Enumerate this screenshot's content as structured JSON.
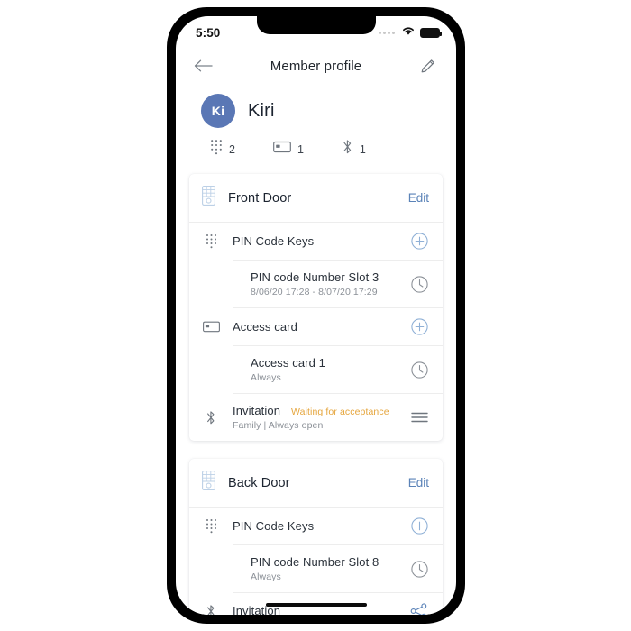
{
  "status_bar": {
    "time": "5:50",
    "signal_icon": "signal-dots-icon",
    "wifi_icon": "wifi-icon",
    "battery_icon": "battery-icon"
  },
  "nav": {
    "back_icon": "back-arrow-icon",
    "title": "Member profile",
    "edit_icon": "pencil-icon"
  },
  "profile": {
    "initials": "Ki",
    "name": "Kiri",
    "avatar_color": "#5a77b5",
    "stats": [
      {
        "icon": "keypad-icon",
        "label": "pin-codes",
        "value": "2"
      },
      {
        "icon": "card-icon",
        "label": "access-cards",
        "value": "1"
      },
      {
        "icon": "bluetooth-icon",
        "label": "invitations",
        "value": "1"
      }
    ]
  },
  "colors": {
    "accent_blue": "#5b83b8",
    "action_blue": "#7596c4",
    "pending_orange": "#e5a53c",
    "muted_gray": "#8b9097"
  },
  "cards": [
    {
      "id": "front-door",
      "icon": "door-lock-icon",
      "title": "Front Door",
      "edit_label": "Edit",
      "rows": [
        {
          "id": "pin-code-keys",
          "icon": "keypad-icon",
          "title": "PIN Code Keys",
          "sub": "",
          "tag": "",
          "action_icon": "plus-circle-icon",
          "indent": false
        },
        {
          "id": "pin-code-slot-3",
          "icon": "",
          "title": "PIN code Number Slot 3",
          "sub": "8/06/20 17:28 - 8/07/20 17:29",
          "tag": "",
          "action_icon": "clock-icon",
          "indent": true
        },
        {
          "id": "access-card",
          "icon": "card-icon",
          "title": "Access card",
          "sub": "",
          "tag": "",
          "action_icon": "plus-circle-icon",
          "indent": false
        },
        {
          "id": "access-card-1",
          "icon": "",
          "title": "Access card 1",
          "sub": "Always",
          "tag": "",
          "action_icon": "clock-icon",
          "indent": true
        },
        {
          "id": "invitation-front",
          "icon": "bluetooth-icon",
          "title": "Invitation",
          "sub": "Family | Always open",
          "tag": "Waiting for acceptance",
          "action_icon": "hamburger-menu-icon",
          "indent": false
        }
      ]
    },
    {
      "id": "back-door",
      "icon": "door-lock-icon",
      "title": "Back Door",
      "edit_label": "Edit",
      "rows": [
        {
          "id": "pin-code-keys-back",
          "icon": "keypad-icon",
          "title": "PIN Code Keys",
          "sub": "",
          "tag": "",
          "action_icon": "plus-circle-icon",
          "indent": false
        },
        {
          "id": "pin-code-slot-8",
          "icon": "",
          "title": "PIN code Number Slot 8",
          "sub": "Always",
          "tag": "",
          "action_icon": "clock-icon",
          "indent": true
        },
        {
          "id": "invitation-back",
          "icon": "bluetooth-icon",
          "title": "Invitation",
          "sub": "",
          "tag": "",
          "action_icon": "share-icon",
          "indent": false
        }
      ]
    }
  ]
}
